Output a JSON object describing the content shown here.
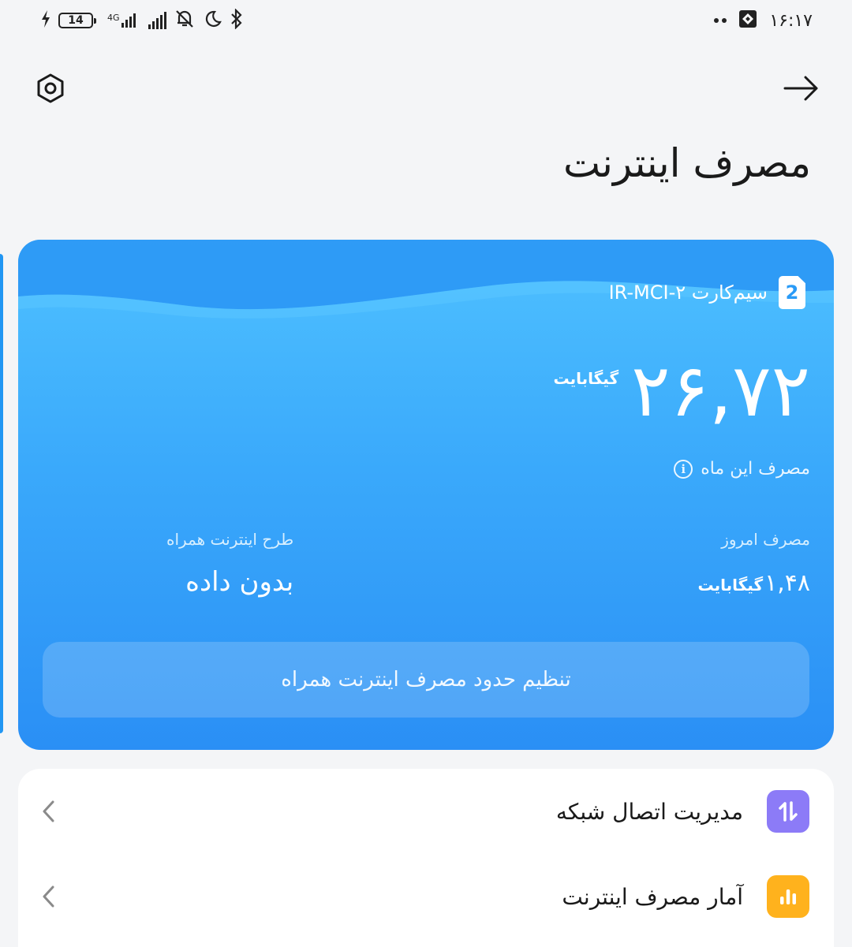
{
  "status_bar": {
    "battery_level": "14",
    "network_type": "4G",
    "time": "۱۶:۱۷",
    "icons": [
      "charging-icon",
      "battery-icon",
      "signal-icon",
      "signal-icon",
      "mute-bell-icon",
      "moon-icon",
      "bluetooth-icon",
      "notification-dots-icon",
      "app-notification-icon"
    ]
  },
  "header": {
    "title": "مصرف اینترنت",
    "settings_icon": "settings-icon",
    "back_icon": "arrow-right-icon"
  },
  "sim_card": {
    "badge": "2",
    "label": "سیم‌کارت ۲-IR-MCI",
    "month_usage_value": "۲۶,۷۲",
    "month_usage_unit": "گیگابایت",
    "month_usage_label": "مصرف این ماه",
    "today_label": "مصرف امروز",
    "today_value": "۱,۴۸",
    "today_unit": "گیگابایت",
    "plan_label": "طرح اینترنت همراه",
    "plan_value": "بدون داده",
    "limit_button_label": "تنظیم حدود مصرف اینترنت همراه",
    "accent_color": "#3aa9fb"
  },
  "list": {
    "items": [
      {
        "label": "مدیریت اتصال شبکه",
        "icon": "network-transfer-icon",
        "icon_color": "#8c7bf7"
      },
      {
        "label": "آمار مصرف اینترنت",
        "icon": "bar-chart-icon",
        "icon_color": "#ffb21d"
      }
    ]
  }
}
